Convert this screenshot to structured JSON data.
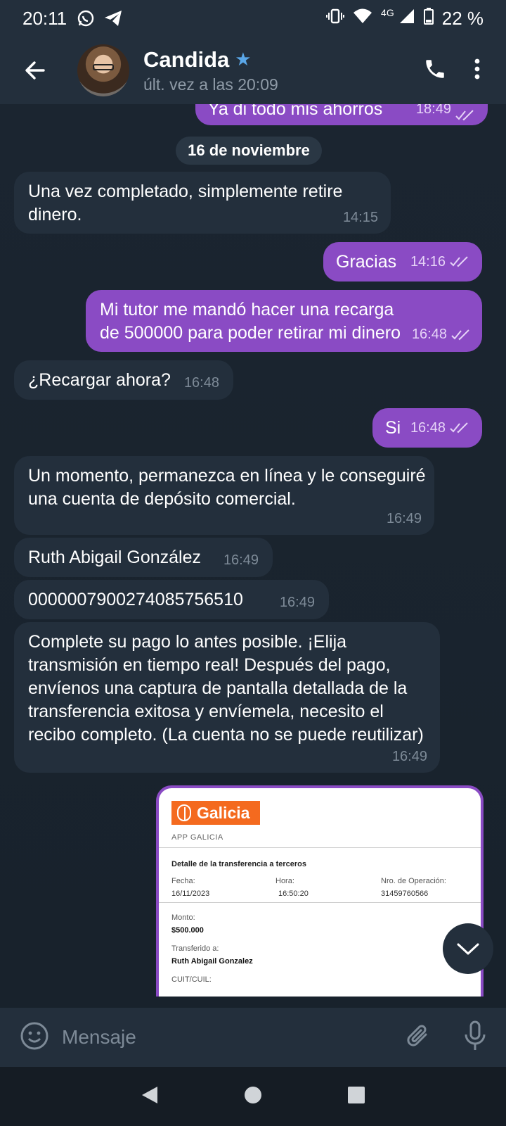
{
  "status_bar": {
    "time": "20:11",
    "network": "4G",
    "battery": "22 %"
  },
  "header": {
    "contact_name": "Candida",
    "last_seen": "últ. vez a las 20:09",
    "verified_icon": "star-icon"
  },
  "chat": {
    "partial_message": {
      "text": "Ya di todo mis ahorros",
      "time": "18:49"
    },
    "date_separator": "16 de noviembre",
    "messages": [
      {
        "dir": "in",
        "text": "Una vez completado, simplemente retire dinero.",
        "time": "14:15"
      },
      {
        "dir": "out",
        "text": "Gracias",
        "time": "14:16"
      },
      {
        "dir": "out",
        "text": "Mi tutor me mandó hacer una recarga de 500000 para poder retirar mi dinero",
        "time": "16:48"
      },
      {
        "dir": "in",
        "text": "¿Recargar ahora?",
        "time": "16:48"
      },
      {
        "dir": "out",
        "text": "Si",
        "time": "16:48"
      },
      {
        "dir": "in",
        "text": "Un momento, permanezca en línea y le conseguiré una cuenta de depósito comercial.",
        "time": "16:49"
      },
      {
        "dir": "in",
        "text": "Ruth Abigail González",
        "time": "16:49"
      },
      {
        "dir": "in",
        "text": "0000007900274085756510",
        "time": "16:49"
      },
      {
        "dir": "in",
        "text": "Complete su pago lo antes posible. ¡Elija transmisión en tiempo real! Después del pago, envíenos una captura de pantalla detallada de la transferencia exitosa y envíemela, necesito el recibo completo. (La cuenta no se puede reutilizar)",
        "time": "16:49"
      }
    ],
    "receipt": {
      "brand": "Galicia",
      "app_label": "APP GALICIA",
      "title": "Detalle de la transferencia a terceros",
      "fecha_label": "Fecha:",
      "fecha": "16/11/2023",
      "hora_label": "Hora:",
      "hora": "16:50:20",
      "op_label": "Nro. de Operación:",
      "op": "31459760566",
      "monto_label": "Monto:",
      "monto": "$500.000",
      "transferido_label": "Transferido a:",
      "transferido": "Ruth Abigail Gonzalez",
      "cuit_label": "CUIT/CUIL:"
    }
  },
  "input": {
    "placeholder": "Mensaje"
  },
  "colors": {
    "outgoing": "#8a4bc4",
    "incoming": "#232f3c",
    "background": "#17212b",
    "accent": "#5aa7e8",
    "brand": "#f46a1f"
  }
}
